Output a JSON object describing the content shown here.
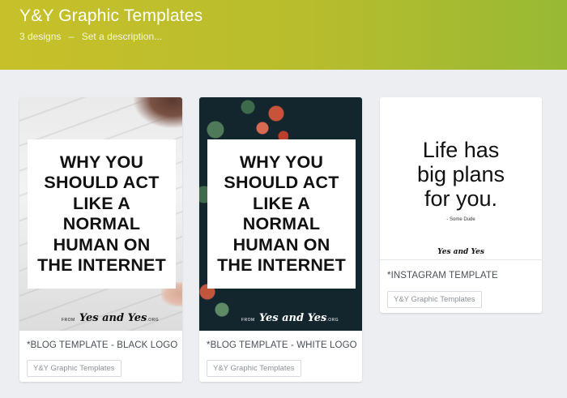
{
  "header": {
    "title": "Y&Y Graphic Templates",
    "design_count": "3 designs",
    "separator": "–",
    "description_placeholder": "Set a description..."
  },
  "colors": {
    "header_gradient_start": "#c7c02a",
    "header_gradient_end": "#98b934",
    "page_background": "#eceef1",
    "blog_dark_background": "#13262d"
  },
  "cards": [
    {
      "label": "*BLOG TEMPLATE - BLACK LOGO",
      "tag": "Y&Y Graphic Templates",
      "thumb_headline": "WHY YOU\nSHOULD ACT\nLIKE A\nNORMAL\nHUMAN ON\nTHE INTERNET",
      "thumb_brand_prefix": "FROM",
      "thumb_brand_name": "Yes and Yes",
      "thumb_brand_suffix": ".ORG"
    },
    {
      "label": "*BLOG TEMPLATE - WHITE LOGO",
      "tag": "Y&Y Graphic Templates",
      "thumb_headline": "WHY YOU\nSHOULD ACT\nLIKE A\nNORMAL\nHUMAN ON\nTHE INTERNET",
      "thumb_brand_prefix": "FROM",
      "thumb_brand_name": "Yes and Yes",
      "thumb_brand_suffix": ".ORG"
    },
    {
      "label": "*INSTAGRAM TEMPLATE",
      "tag": "Y&Y Graphic Templates",
      "thumb_quote": "Life has\nbig plans\nfor you.",
      "thumb_attribution": "- Some Dude",
      "thumb_logo": "Yes and Yes"
    }
  ]
}
